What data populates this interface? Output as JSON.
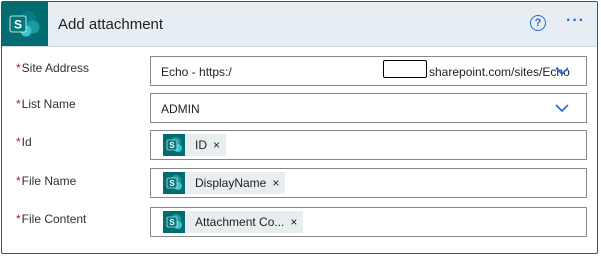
{
  "header": {
    "title": "Add attachment",
    "help_icon": "question-circle-icon",
    "more_icon": "ellipsis-icon",
    "more_label": "···",
    "help_label": "?"
  },
  "fields": {
    "site_address": {
      "label": "Site Address",
      "required_mark": "*",
      "value_prefix": "Echo - https:/",
      "value_suffix": "sharepoint.com/sites/Echo"
    },
    "list_name": {
      "label": "List Name",
      "required_mark": "*",
      "value": "ADMIN"
    },
    "id": {
      "label": "Id",
      "required_mark": "*",
      "token": "ID"
    },
    "file_name": {
      "label": "File Name",
      "required_mark": "*",
      "token": "DisplayName"
    },
    "file_content": {
      "label": "File Content",
      "required_mark": "*",
      "token": "Attachment Co..."
    }
  },
  "token_remove": "×",
  "colors": {
    "brand": "#036c70",
    "accent": "#2266e3",
    "required": "#a4262c"
  }
}
